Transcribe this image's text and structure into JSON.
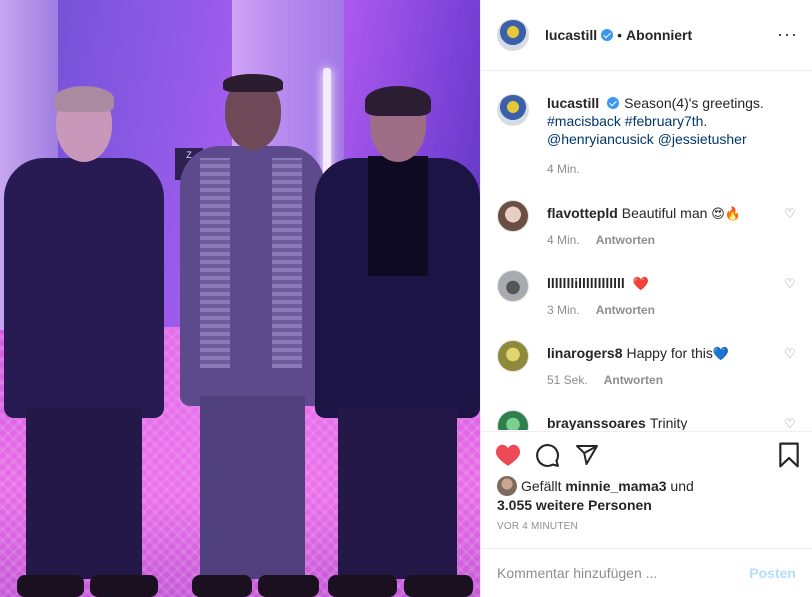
{
  "post": {
    "author": {
      "username": "lucastill",
      "verified": true,
      "follow_status": "Abonniert",
      "separator": "•"
    },
    "caption": {
      "username": "lucastill",
      "text": "Season(4)'s greetings.",
      "hashtags": "#macisback #february7th.",
      "mentions": "@henryiancusick @jessietusher",
      "time": "4 Min."
    },
    "comments": [
      {
        "username": "flavottepld",
        "text": "Beautiful man",
        "emoji": "😍🔥",
        "time": "4 Min.",
        "reply_label": "Antworten",
        "avatar_color": "#d9c7c0"
      },
      {
        "username": "lllllllillllllllllll",
        "text": "",
        "emoji": "❤️",
        "time": "3 Min.",
        "reply_label": "Antworten",
        "avatar_color": "#8a8f94"
      },
      {
        "username": "linarogers8",
        "text": "Happy for this",
        "emoji": "💙",
        "time": "51 Sek.",
        "reply_label": "Antworten",
        "avatar_color": "#b8b45a"
      },
      {
        "username": "brayanssoares",
        "text": "Trinity",
        "emoji": "",
        "time": "",
        "reply_label": "",
        "avatar_color": "#3a9a5a"
      }
    ],
    "likes": {
      "prefix": "Gefällt",
      "first_liker": "minnie_mama3",
      "conjunction": "und",
      "others": "3.055 weitere Personen"
    },
    "timestamp": "VOR 4 MINUTEN",
    "add_comment": {
      "placeholder": "Kommentar hinzufügen ...",
      "post_label": "Posten"
    },
    "icons": {
      "like": "heart-icon",
      "comment": "comment-icon",
      "share": "share-icon",
      "save": "bookmark-icon",
      "more": "more-icon"
    },
    "colors": {
      "liked_heart": "#ed4956",
      "link": "#00376b",
      "verified": "#3897f0",
      "post_button": "#b2dffc"
    },
    "photo_sign": "Z\n← SPA"
  }
}
